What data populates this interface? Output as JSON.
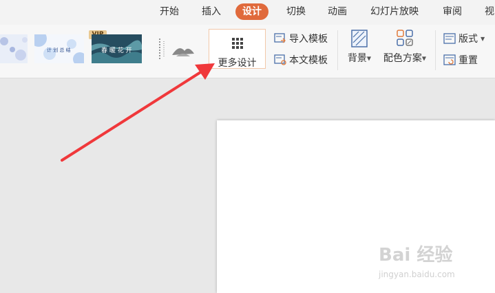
{
  "tabs": [
    {
      "label": "开始",
      "active": false
    },
    {
      "label": "插入",
      "active": false
    },
    {
      "label": "设计",
      "active": true
    },
    {
      "label": "切换",
      "active": false
    },
    {
      "label": "动画",
      "active": false
    },
    {
      "label": "幻灯片放映",
      "active": false
    },
    {
      "label": "审阅",
      "active": false
    },
    {
      "label": "视",
      "active": false
    }
  ],
  "ribbon": {
    "vip_badge": "VIP",
    "thumbnails": [
      {
        "text": ""
      },
      {
        "text": "计 划 总 结"
      },
      {
        "text": "春 暖 花 开"
      },
      {
        "text": ""
      }
    ],
    "more_design": "更多设计",
    "import_template": "导入模板",
    "this_template": "本文模板",
    "background": "背景",
    "color_scheme": "配色方案",
    "layout": "版式",
    "reset": "重置"
  },
  "watermark": {
    "brand": "Bai 经验",
    "url": "jingyan.baidu.com"
  },
  "colors": {
    "active_tab": "#e06a3c",
    "arrow": "#f0383b"
  }
}
